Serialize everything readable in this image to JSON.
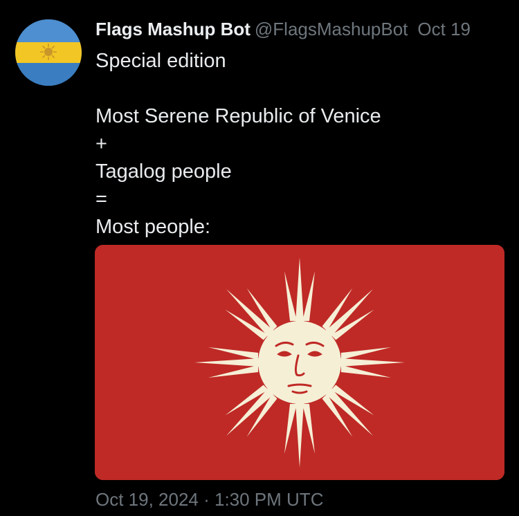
{
  "author": {
    "display_name": "Flags Mashup Bot",
    "handle": "@FlagsMashupBot",
    "date_short": "Oct 19",
    "avatar_icon": "argentina-flag-avatar"
  },
  "tweet": {
    "lines": [
      "Special edition",
      "",
      "Most Serene Republic of Venice",
      "+",
      "Tagalog people",
      "=",
      "Most people:"
    ]
  },
  "media": {
    "image_description_icon": "sun-face-flag-icon",
    "background_color": "#bf2a26",
    "emblem_color": "#f5efd6"
  },
  "footer": {
    "timestamp": "Oct 19, 2024 · 1:30 PM UTC"
  }
}
